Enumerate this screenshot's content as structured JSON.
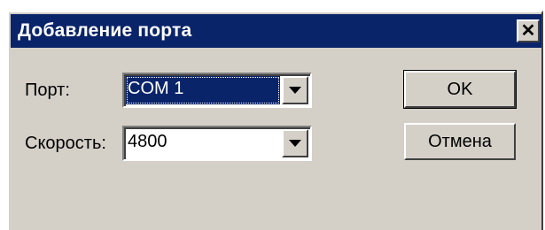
{
  "dialog": {
    "title": "Добавление порта",
    "close_glyph": "✕"
  },
  "form": {
    "port_label": "Порт:",
    "port_value": "COM 1",
    "speed_label": "Скорость:",
    "speed_value": "4800"
  },
  "buttons": {
    "ok_label": "OK",
    "cancel_label": "Отмена"
  },
  "icons": {
    "close": "close-icon",
    "dropdown": "chevron-down-icon"
  },
  "colors": {
    "titlebar": "#0a246a",
    "face": "#d4d0c8",
    "selection": "#0a246a"
  }
}
